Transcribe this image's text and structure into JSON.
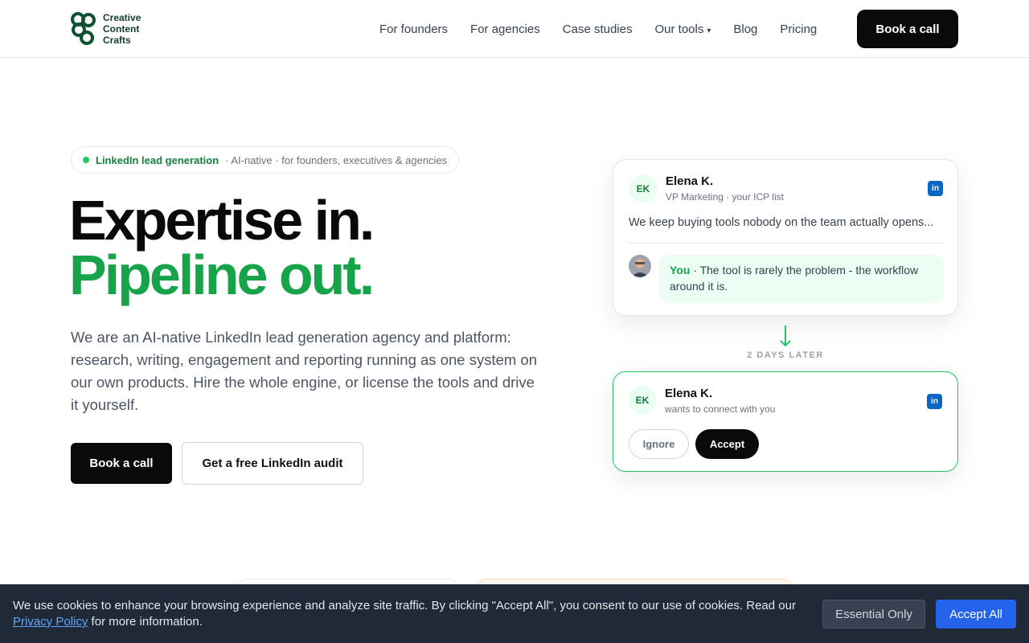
{
  "header": {
    "logo_lines": [
      "Creative",
      "Content",
      "Crafts"
    ],
    "nav": [
      {
        "label": "For founders"
      },
      {
        "label": "For agencies"
      },
      {
        "label": "Case studies"
      },
      {
        "label": "Our tools",
        "caret": "▾"
      },
      {
        "label": "Blog"
      },
      {
        "label": "Pricing"
      }
    ],
    "cta": "Book a call"
  },
  "hero": {
    "pill_strong": "LinkedIn lead generation",
    "pill_rest": "· AI-native · for founders, executives & agencies",
    "headline_1": "Expertise in.",
    "headline_2": "Pipeline out.",
    "lead": "We are an AI-native LinkedIn lead generation agency and platform: research, writing, engagement and reporting running as one system on our own products. Hire the whole engine, or license the tools and drive it yourself.",
    "primary_cta": "Book a call",
    "secondary_cta": "Get a free LinkedIn audit"
  },
  "card1": {
    "initials": "EK",
    "name": "Elena K.",
    "subtitle": "VP Marketing · your ICP list",
    "badge": "in",
    "message": "We keep buying tools nobody on the team actually opens...",
    "reply_author": "You",
    "reply_text": " · The tool is rarely the problem - the workflow around it is."
  },
  "transition": {
    "label": "2 DAYS LATER",
    "arrow": "↓"
  },
  "card2": {
    "initials": "EK",
    "name": "Elena K.",
    "subtitle": "wants to connect with you",
    "badge": "in",
    "ignore": "Ignore",
    "accept": "Accept"
  },
  "cookie": {
    "text_before": "We use cookies to enhance your browsing experience and analyze site traffic. By clicking \"Accept All\", you consent to our use of cookies. Read our ",
    "link": "Privacy Policy",
    "text_after": " for more information.",
    "essential": "Essential Only",
    "accept_all": "Accept All"
  },
  "colors": {
    "accent_green": "#16a34a",
    "dark": "#0a0a0a",
    "linkedin_blue": "#0a66c2",
    "cookie_bg": "#1f2937",
    "cookie_button": "#2563eb"
  },
  "icons": {
    "logo": "creative-content-crafts-logo-icon",
    "linkedin": "linkedin-icon",
    "arrow": "arrow-down-icon"
  }
}
